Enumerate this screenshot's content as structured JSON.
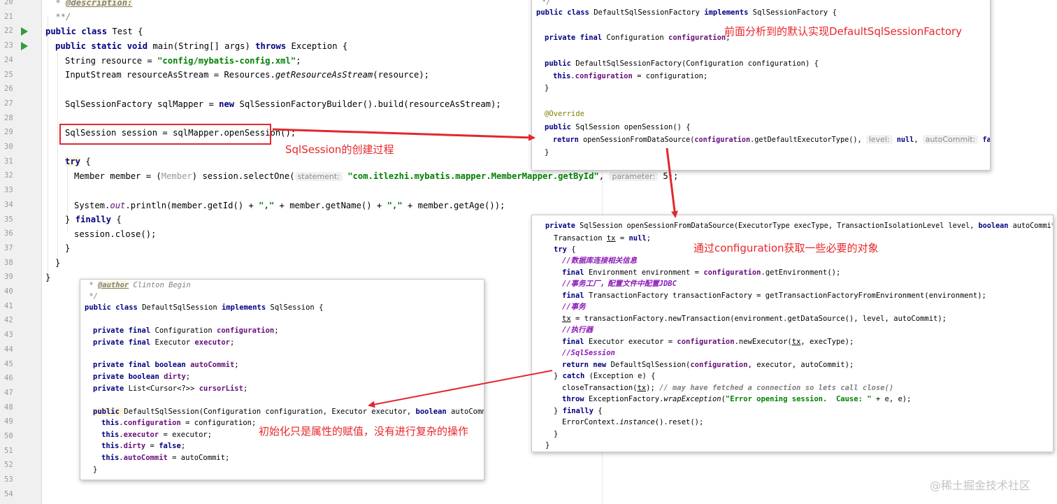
{
  "editor": {
    "line_numbers": [
      "20",
      "21",
      "22",
      "23",
      "24",
      "25",
      "26",
      "27",
      "28",
      "29",
      "30",
      "31",
      "32",
      "33",
      "34",
      "35",
      "36",
      "37",
      "38",
      "39",
      "40",
      "41",
      "42",
      "43",
      "44",
      "45",
      "46",
      "47",
      "48",
      "49",
      "50",
      "51",
      "52",
      "53",
      "54"
    ],
    "lines": {
      "l20_star": " * ",
      "l20_tag": "@description:",
      "l21": " **/",
      "l22_kw": "public class ",
      "l22_rest": "Test {",
      "l23_kw1": "public static void ",
      "l23_mid": "main(String[] args) ",
      "l23_kw2": "throws ",
      "l23_rest": "Exception {",
      "l24_a": "String resource = ",
      "l24_str": "\"config/mybatis-config.xml\"",
      "l24_b": ";",
      "l25_a": "InputStream resourceAsStream = Resources.",
      "l25_it": "getResourceAsStream",
      "l25_b": "(resource);",
      "l27_a": "SqlSessionFactory sqlMapper = ",
      "l27_kw": "new ",
      "l27_b": "SqlSessionFactoryBuilder().build(resourceAsStream);",
      "l29": "SqlSession session = sqlMapper.openSession();",
      "l31_kw": "try",
      "l31_b": " {",
      "l32_a": "Member member = (",
      "l32_g": "Member",
      "l32_b": ") session.selectOne(",
      "l32_hint1": "statement:",
      "l32_str": " \"com.itlezhi.mybatis.mapper.MemberMapper.getById\"",
      "l32_c": ", ",
      "l32_hint2": "parameter:",
      "l32_d": " 5);",
      "l34_a": "System.",
      "l34_out": "out",
      "l34_b": ".println(member.getId() + ",
      "l34_s1": "\",\"",
      "l34_c": " + member.getName() + ",
      "l34_s2": "\",\"",
      "l34_d": " + member.getAge());",
      "l35_a": "} ",
      "l35_kw": "finally",
      "l35_b": " {",
      "l36": "session.close();",
      "l37": "}",
      "l38": "}",
      "l39": "}"
    }
  },
  "popup_factory": {
    "lines": {
      "p0": "*/",
      "p1_kw1": "public class ",
      "p1_a": "DefaultSqlSessionFactory ",
      "p1_kw2": "implements ",
      "p1_b": "SqlSessionFactory {",
      "p3_kw": "private final ",
      "p3_a": "Configuration ",
      "p3_f": "configuration",
      "p3_b": ";",
      "p5_kw": "public ",
      "p5_a": "DefaultSqlSessionFactory(Configuration configuration) {",
      "p6_kw": "this",
      "p6_a": ".",
      "p6_f": "configuration",
      "p6_b": " = configuration;",
      "p7": "}",
      "p9": "@Override",
      "p10_kw": "public ",
      "p10_a": "SqlSession openSession() {",
      "p11_kw": "return ",
      "p11_a": "openSessionFromDataSource(",
      "p11_f": "configuration",
      "p11_b": ".getDefaultExecutorType(),",
      "p11_h1": "level:",
      "p11_n1": "null",
      "p11_c": ",",
      "p11_h2": "autoCommit:",
      "p11_n2": "false",
      "p11_d": ");",
      "p12": "}"
    }
  },
  "popup_open": {
    "lines": {
      "o1_kw1": "private ",
      "o1_a": "SqlSession openSessionFromDataSource(ExecutorType execType, TransactionIsolationLevel level, ",
      "o1_kw2": "boolean ",
      "o1_b": "autoCommit) {",
      "o2_a": "Transaction ",
      "o2_u": "tx",
      "o2_b": " = ",
      "o2_kw": "null",
      "o2_c": ";",
      "o3_kw": "try",
      "o3_a": " {",
      "o4": "//数据库连接相关信息",
      "o5_kw": "final ",
      "o5_a": "Environment environment = ",
      "o5_f": "configuration",
      "o5_b": ".getEnvironment();",
      "o6": "//事务工厂，配置文件中配置JDBC",
      "o7_kw": "final ",
      "o7_a": "TransactionFactory transactionFactory = getTransactionFactoryFromEnvironment(environment);",
      "o8": "//事务",
      "o9_u": "tx",
      "o9_a": " = transactionFactory.newTransaction(environment.getDataSource(), level, autoCommit);",
      "o10": "//执行器",
      "o11_kw": "final ",
      "o11_a": "Executor executor = ",
      "o11_f": "configuration",
      "o11_b": ".newExecutor(",
      "o11_u": "tx",
      "o11_c": ", execType);",
      "o12": "//SqlSession",
      "o13_kw1": "return ",
      "o13_kw2": "new ",
      "o13_a": "DefaultSqlSession(",
      "o13_f": "configuration",
      "o13_b": ", executor, autoCommit);",
      "o14_a": "} ",
      "o14_kw": "catch",
      "o14_b": " (Exception e) {",
      "o15_a": "closeTransaction(",
      "o15_u": "tx",
      "o15_b": "); ",
      "o15_cm": "// may have fetched a connection so lets call close()",
      "o16_kw": "throw ",
      "o16_a": "ExceptionFactory.",
      "o16_it": "wrapException",
      "o16_b": "(",
      "o16_s": "\"Error opening session.  Cause: \"",
      "o16_c": " + e, e);",
      "o17_a": "} ",
      "o17_kw": "finally",
      "o17_b": " {",
      "o18_a": "ErrorContext.",
      "o18_it": "instance",
      "o18_b": "().reset();",
      "o19": "}",
      "o20": "}"
    }
  },
  "popup_session": {
    "lines": {
      "s0_a": " * ",
      "s0_tag": "@author",
      "s0_b": " Clinton Begin",
      "s1": " */",
      "s2_kw1": "public class ",
      "s2_a": "DefaultSqlSession ",
      "s2_kw2": "implements ",
      "s2_b": "SqlSession {",
      "s4_kw": "private final ",
      "s4_a": "Configuration ",
      "s4_f": "configuration",
      "s4_b": ";",
      "s5_kw": "private final ",
      "s5_a": "Executor ",
      "s5_f": "executor",
      "s5_b": ";",
      "s7_kw": "private final boolean ",
      "s7_f": "autoCommit",
      "s7_b": ";",
      "s8_kw": "private boolean ",
      "s8_f": "dirty",
      "s8_b": ";",
      "s9_kw": "private ",
      "s9_a": "List<Cursor<?>> ",
      "s9_f": "cursorList",
      "s9_b": ";",
      "s11_kw": "public ",
      "s11_a": "DefaultSqlSession(Configuration configuration, Executor executor, ",
      "s11_kw2": "boolean ",
      "s11_b": "autoCommit) {",
      "s12_kw": "this",
      "s12_a": ".",
      "s12_f": "configuration",
      "s12_b": " = configuration;",
      "s13_kw": "this",
      "s13_a": ".",
      "s13_f": "executor",
      "s13_b": " = executor;",
      "s14_kw": "this",
      "s14_a": ".",
      "s14_f": "dirty",
      "s14_b": " = ",
      "s14_kw2": "false",
      "s14_c": ";",
      "s15_kw": "this",
      "s15_a": ".",
      "s15_f": "autoCommit",
      "s15_b": " = autoCommit;",
      "s16": "}"
    }
  },
  "annotations": {
    "sqlsession_creation": "SqlSession的创建过程",
    "factory_default": "前面分析到的默认实现DefaultSqlSessionFactory",
    "via_configuration": "通过configuration获取一些必要的对象",
    "init_assignment": "初始化只是属性的赋值，没有进行复杂的操作"
  },
  "watermark": "@稀土掘金技术社区",
  "colors": {
    "keyword": "#000080",
    "string": "#008000",
    "field": "#660e7a",
    "annotation_red": "#e8262a",
    "run_icon": "#2e9d3a"
  }
}
